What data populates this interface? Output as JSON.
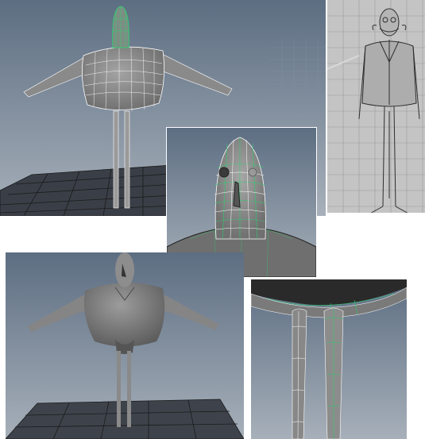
{
  "collage": {
    "background": "#ffffff",
    "panels": [
      {
        "id": "wireframe-full-body",
        "view": "perspective",
        "shading": "wireframe-on-shaded"
      },
      {
        "id": "concept-sketch-reference",
        "view": "front",
        "shading": "reference-image"
      },
      {
        "id": "wireframe-head-closeup",
        "view": "perspective",
        "shading": "wireframe-on-shaded"
      },
      {
        "id": "smooth-shaded-body",
        "view": "perspective",
        "shading": "smooth"
      },
      {
        "id": "wireframe-legs-closeup",
        "view": "perspective",
        "shading": "wireframe-on-shaded"
      }
    ]
  },
  "colors": {
    "viewport_top": "#5d6e82",
    "viewport_bottom": "#a7b0ba",
    "grid_line": "#111111",
    "model_fill": "#8f8f8f",
    "model_dark": "#5a5a5a",
    "wire": "#ffffff",
    "selection": "#2ecc71",
    "sketch_bg": "#c4c4c4",
    "sketch_grid": "#9a9a9a",
    "sketch_line": "#2e2e2e",
    "ref_grid_blue": "#7d8fb0"
  },
  "icons": {
    "model": "3d-character-model-icon",
    "grid": "ground-grid-icon"
  }
}
